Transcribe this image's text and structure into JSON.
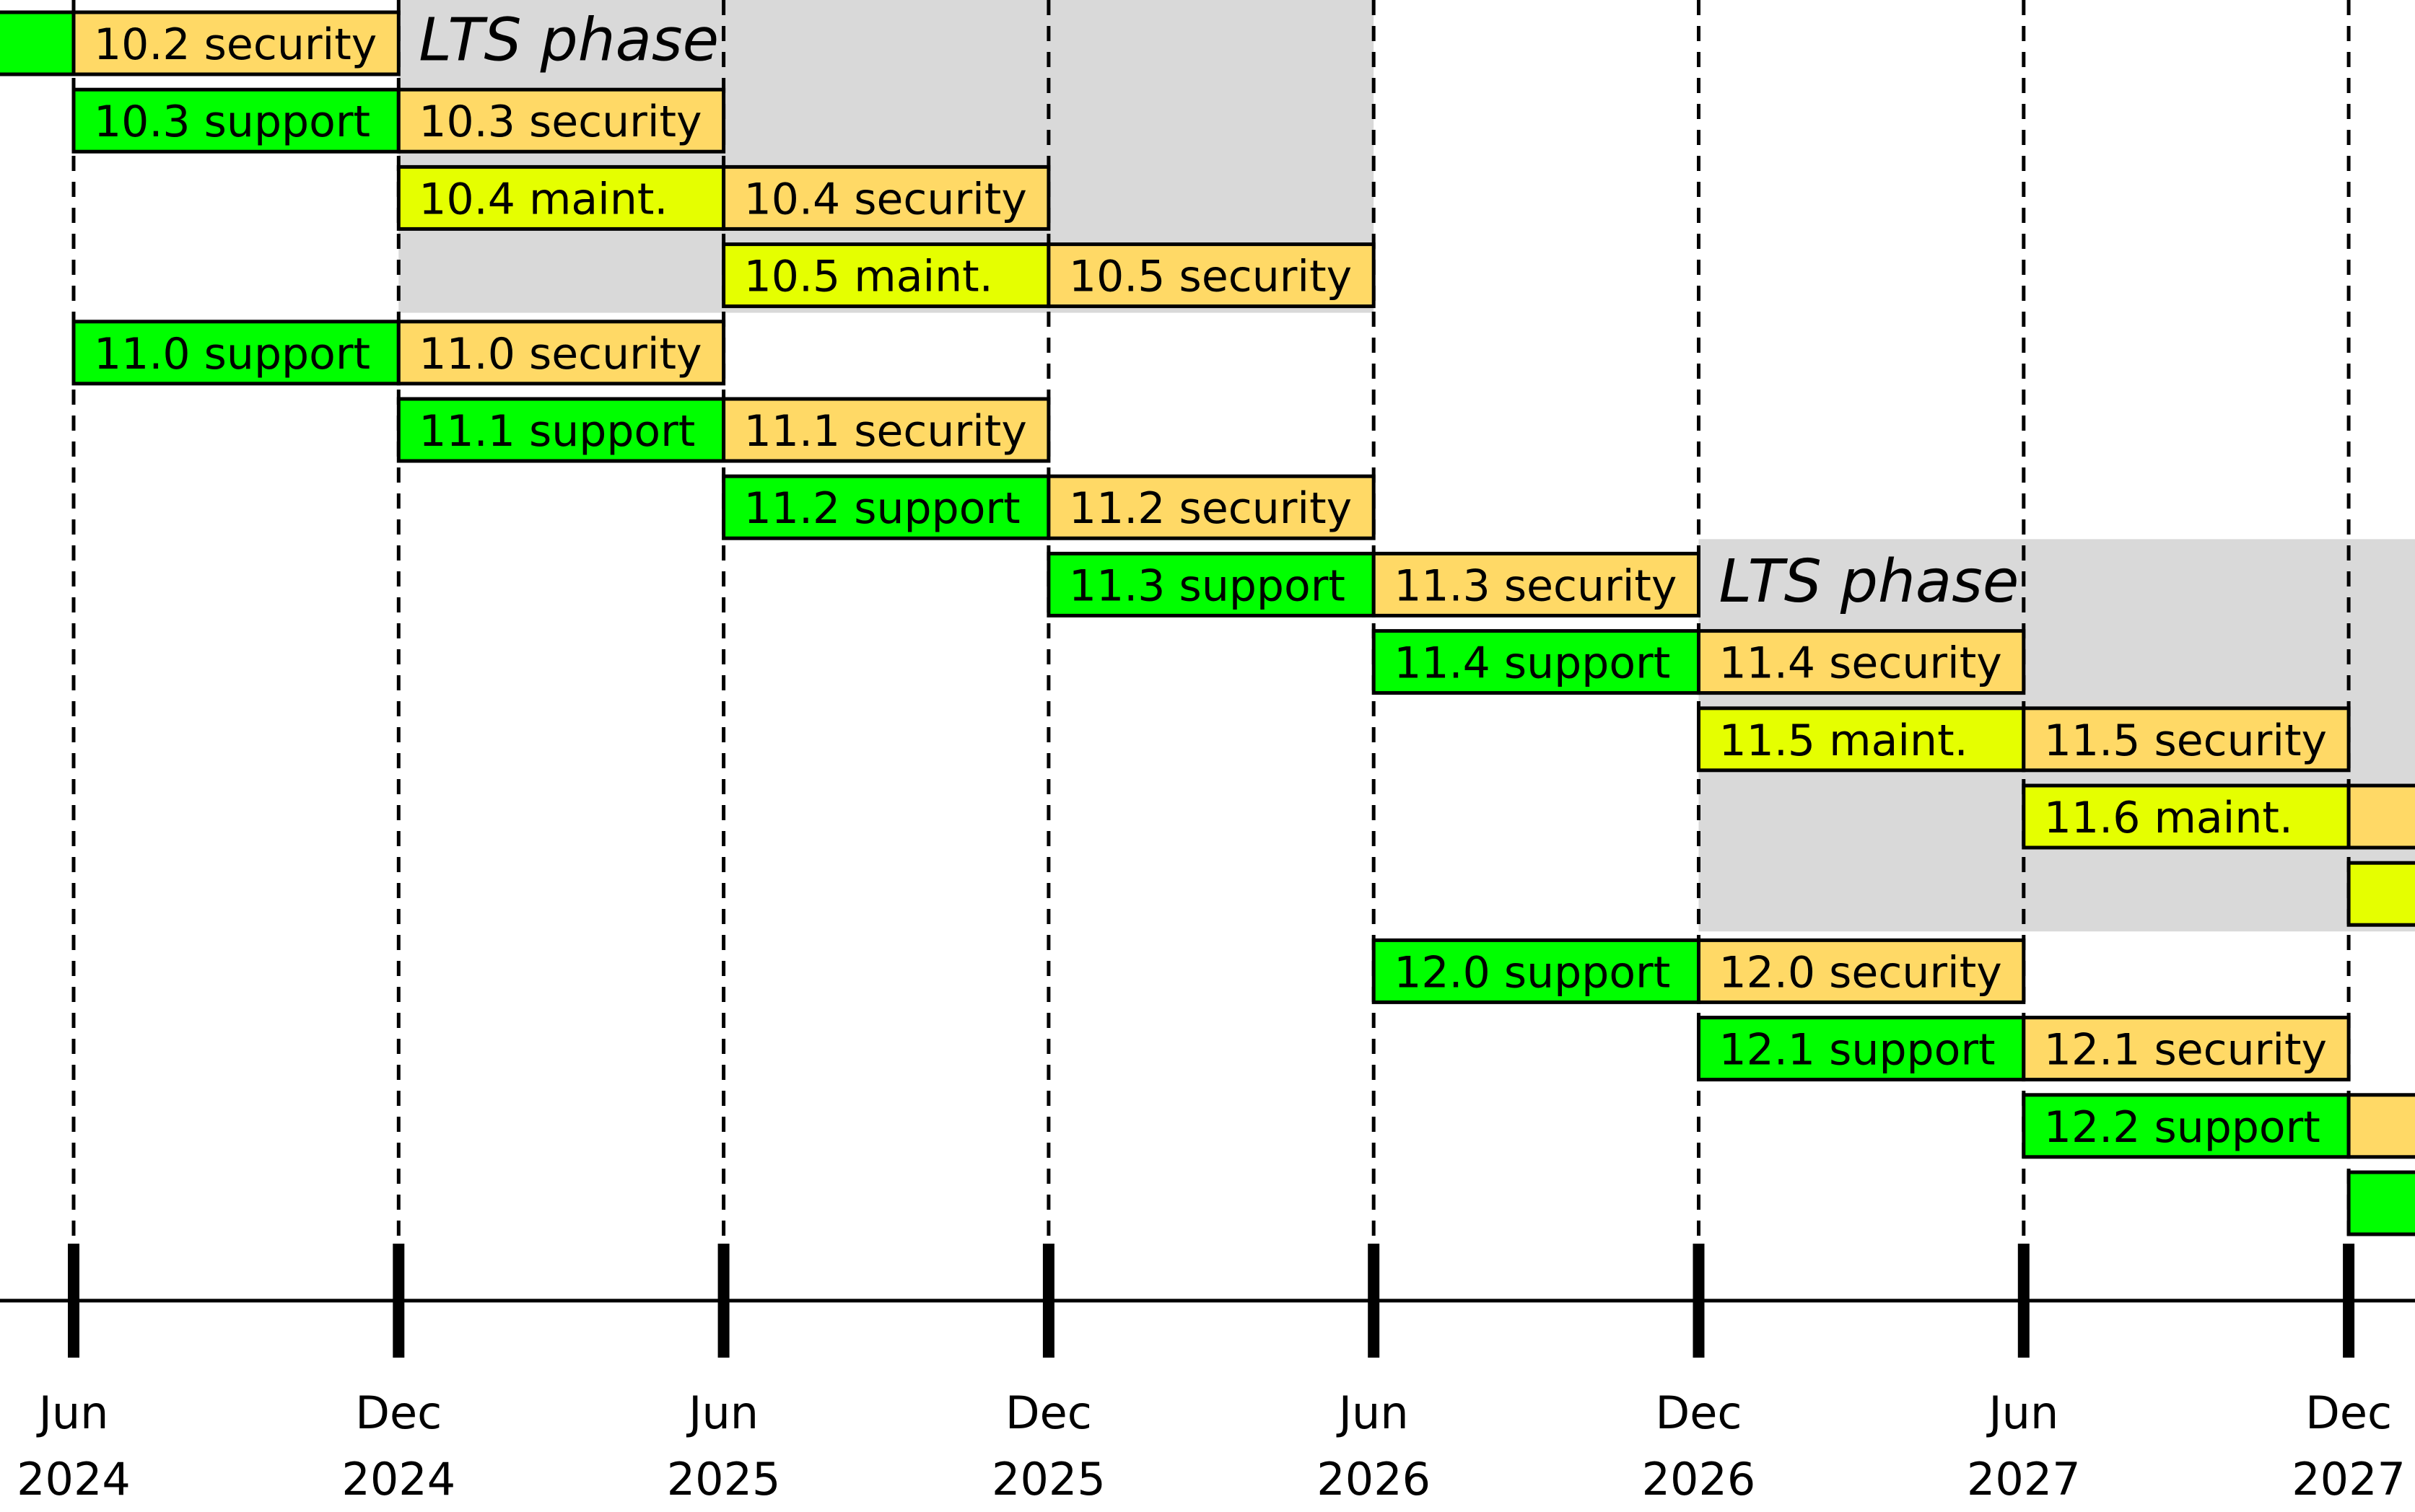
{
  "chart_data": {
    "type": "gantt",
    "title": "",
    "xlabel": "",
    "ylabel": "",
    "time_unit": "month",
    "x_ticks": [
      {
        "month": "Jun",
        "year": "2024",
        "date": "2024-06"
      },
      {
        "month": "Dec",
        "year": "2024",
        "date": "2024-12"
      },
      {
        "month": "Jun",
        "year": "2025",
        "date": "2025-06"
      },
      {
        "month": "Dec",
        "year": "2025",
        "date": "2025-12"
      },
      {
        "month": "Jun",
        "year": "2026",
        "date": "2026-06"
      },
      {
        "month": "Dec",
        "year": "2026",
        "date": "2026-12"
      },
      {
        "month": "Jun",
        "year": "2027",
        "date": "2027-06"
      },
      {
        "month": "Dec",
        "year": "2027",
        "date": "2027-12"
      }
    ],
    "gridlines": "dashed vertical at each tick",
    "phase_colors": {
      "support": "#00ff00",
      "maint.": "#e5ff00",
      "security": "#ffd966",
      "lts_background": "#d9d9d9",
      "border": "#000000"
    },
    "lts_phases": [
      {
        "label": "LTS phase",
        "start": "2024-12",
        "end": "2026-06",
        "first_row": 0,
        "last_row": 3
      },
      {
        "label": "LTS phase",
        "start": "2026-12",
        "end": null,
        "first_row": 7,
        "last_row": 11
      }
    ],
    "rows": [
      {
        "version": "10.2",
        "segments": [
          {
            "phase": "support",
            "label": "",
            "start": null,
            "end": "2024-06"
          },
          {
            "phase": "security",
            "label": "10.2 security",
            "start": "2024-06",
            "end": "2024-12"
          }
        ]
      },
      {
        "version": "10.3",
        "segments": [
          {
            "phase": "support",
            "label": "10.3 support",
            "start": "2024-06",
            "end": "2024-12"
          },
          {
            "phase": "security",
            "label": "10.3 security",
            "start": "2024-12",
            "end": "2025-06"
          }
        ]
      },
      {
        "version": "10.4",
        "segments": [
          {
            "phase": "maint.",
            "label": "10.4 maint.",
            "start": "2024-12",
            "end": "2025-06"
          },
          {
            "phase": "security",
            "label": "10.4 security",
            "start": "2025-06",
            "end": "2025-12"
          }
        ]
      },
      {
        "version": "10.5",
        "segments": [
          {
            "phase": "maint.",
            "label": "10.5 maint.",
            "start": "2025-06",
            "end": "2025-12"
          },
          {
            "phase": "security",
            "label": "10.5 security",
            "start": "2025-12",
            "end": "2026-06"
          }
        ]
      },
      {
        "version": "11.0",
        "segments": [
          {
            "phase": "support",
            "label": "11.0 support",
            "start": "2024-06",
            "end": "2024-12"
          },
          {
            "phase": "security",
            "label": "11.0 security",
            "start": "2024-12",
            "end": "2025-06"
          }
        ]
      },
      {
        "version": "11.1",
        "segments": [
          {
            "phase": "support",
            "label": "11.1 support",
            "start": "2024-12",
            "end": "2025-06"
          },
          {
            "phase": "security",
            "label": "11.1 security",
            "start": "2025-06",
            "end": "2025-12"
          }
        ]
      },
      {
        "version": "11.2",
        "segments": [
          {
            "phase": "support",
            "label": "11.2 support",
            "start": "2025-06",
            "end": "2025-12"
          },
          {
            "phase": "security",
            "label": "11.2 security",
            "start": "2025-12",
            "end": "2026-06"
          }
        ]
      },
      {
        "version": "11.3",
        "segments": [
          {
            "phase": "support",
            "label": "11.3 support",
            "start": "2025-12",
            "end": "2026-06"
          },
          {
            "phase": "security",
            "label": "11.3 security",
            "start": "2026-06",
            "end": "2026-12"
          }
        ]
      },
      {
        "version": "11.4",
        "segments": [
          {
            "phase": "support",
            "label": "11.4 support",
            "start": "2026-06",
            "end": "2026-12"
          },
          {
            "phase": "security",
            "label": "11.4 security",
            "start": "2026-12",
            "end": "2027-06"
          }
        ]
      },
      {
        "version": "11.5",
        "segments": [
          {
            "phase": "maint.",
            "label": "11.5 maint.",
            "start": "2026-12",
            "end": "2027-06"
          },
          {
            "phase": "security",
            "label": "11.5 security",
            "start": "2027-06",
            "end": "2027-12"
          }
        ]
      },
      {
        "version": "11.6",
        "segments": [
          {
            "phase": "maint.",
            "label": "11.6 maint.",
            "start": "2027-06",
            "end": "2027-12"
          },
          {
            "phase": "security",
            "label": "",
            "start": "2027-12",
            "end": null
          }
        ]
      },
      {
        "version": "",
        "segments": [
          {
            "phase": "maint.",
            "label": "",
            "start": "2027-12",
            "end": null
          }
        ]
      },
      {
        "version": "12.0",
        "segments": [
          {
            "phase": "support",
            "label": "12.0 support",
            "start": "2026-06",
            "end": "2026-12"
          },
          {
            "phase": "security",
            "label": "12.0 security",
            "start": "2026-12",
            "end": "2027-06"
          }
        ]
      },
      {
        "version": "12.1",
        "segments": [
          {
            "phase": "support",
            "label": "12.1 support",
            "start": "2026-12",
            "end": "2027-06"
          },
          {
            "phase": "security",
            "label": "12.1 security",
            "start": "2027-06",
            "end": "2027-12"
          }
        ]
      },
      {
        "version": "12.2",
        "segments": [
          {
            "phase": "support",
            "label": "12.2 support",
            "start": "2027-06",
            "end": "2027-12"
          },
          {
            "phase": "security",
            "label": "",
            "start": "2027-12",
            "end": null
          }
        ]
      },
      {
        "version": "",
        "segments": [
          {
            "phase": "support",
            "label": "",
            "start": "2027-12",
            "end": null
          }
        ]
      }
    ]
  }
}
